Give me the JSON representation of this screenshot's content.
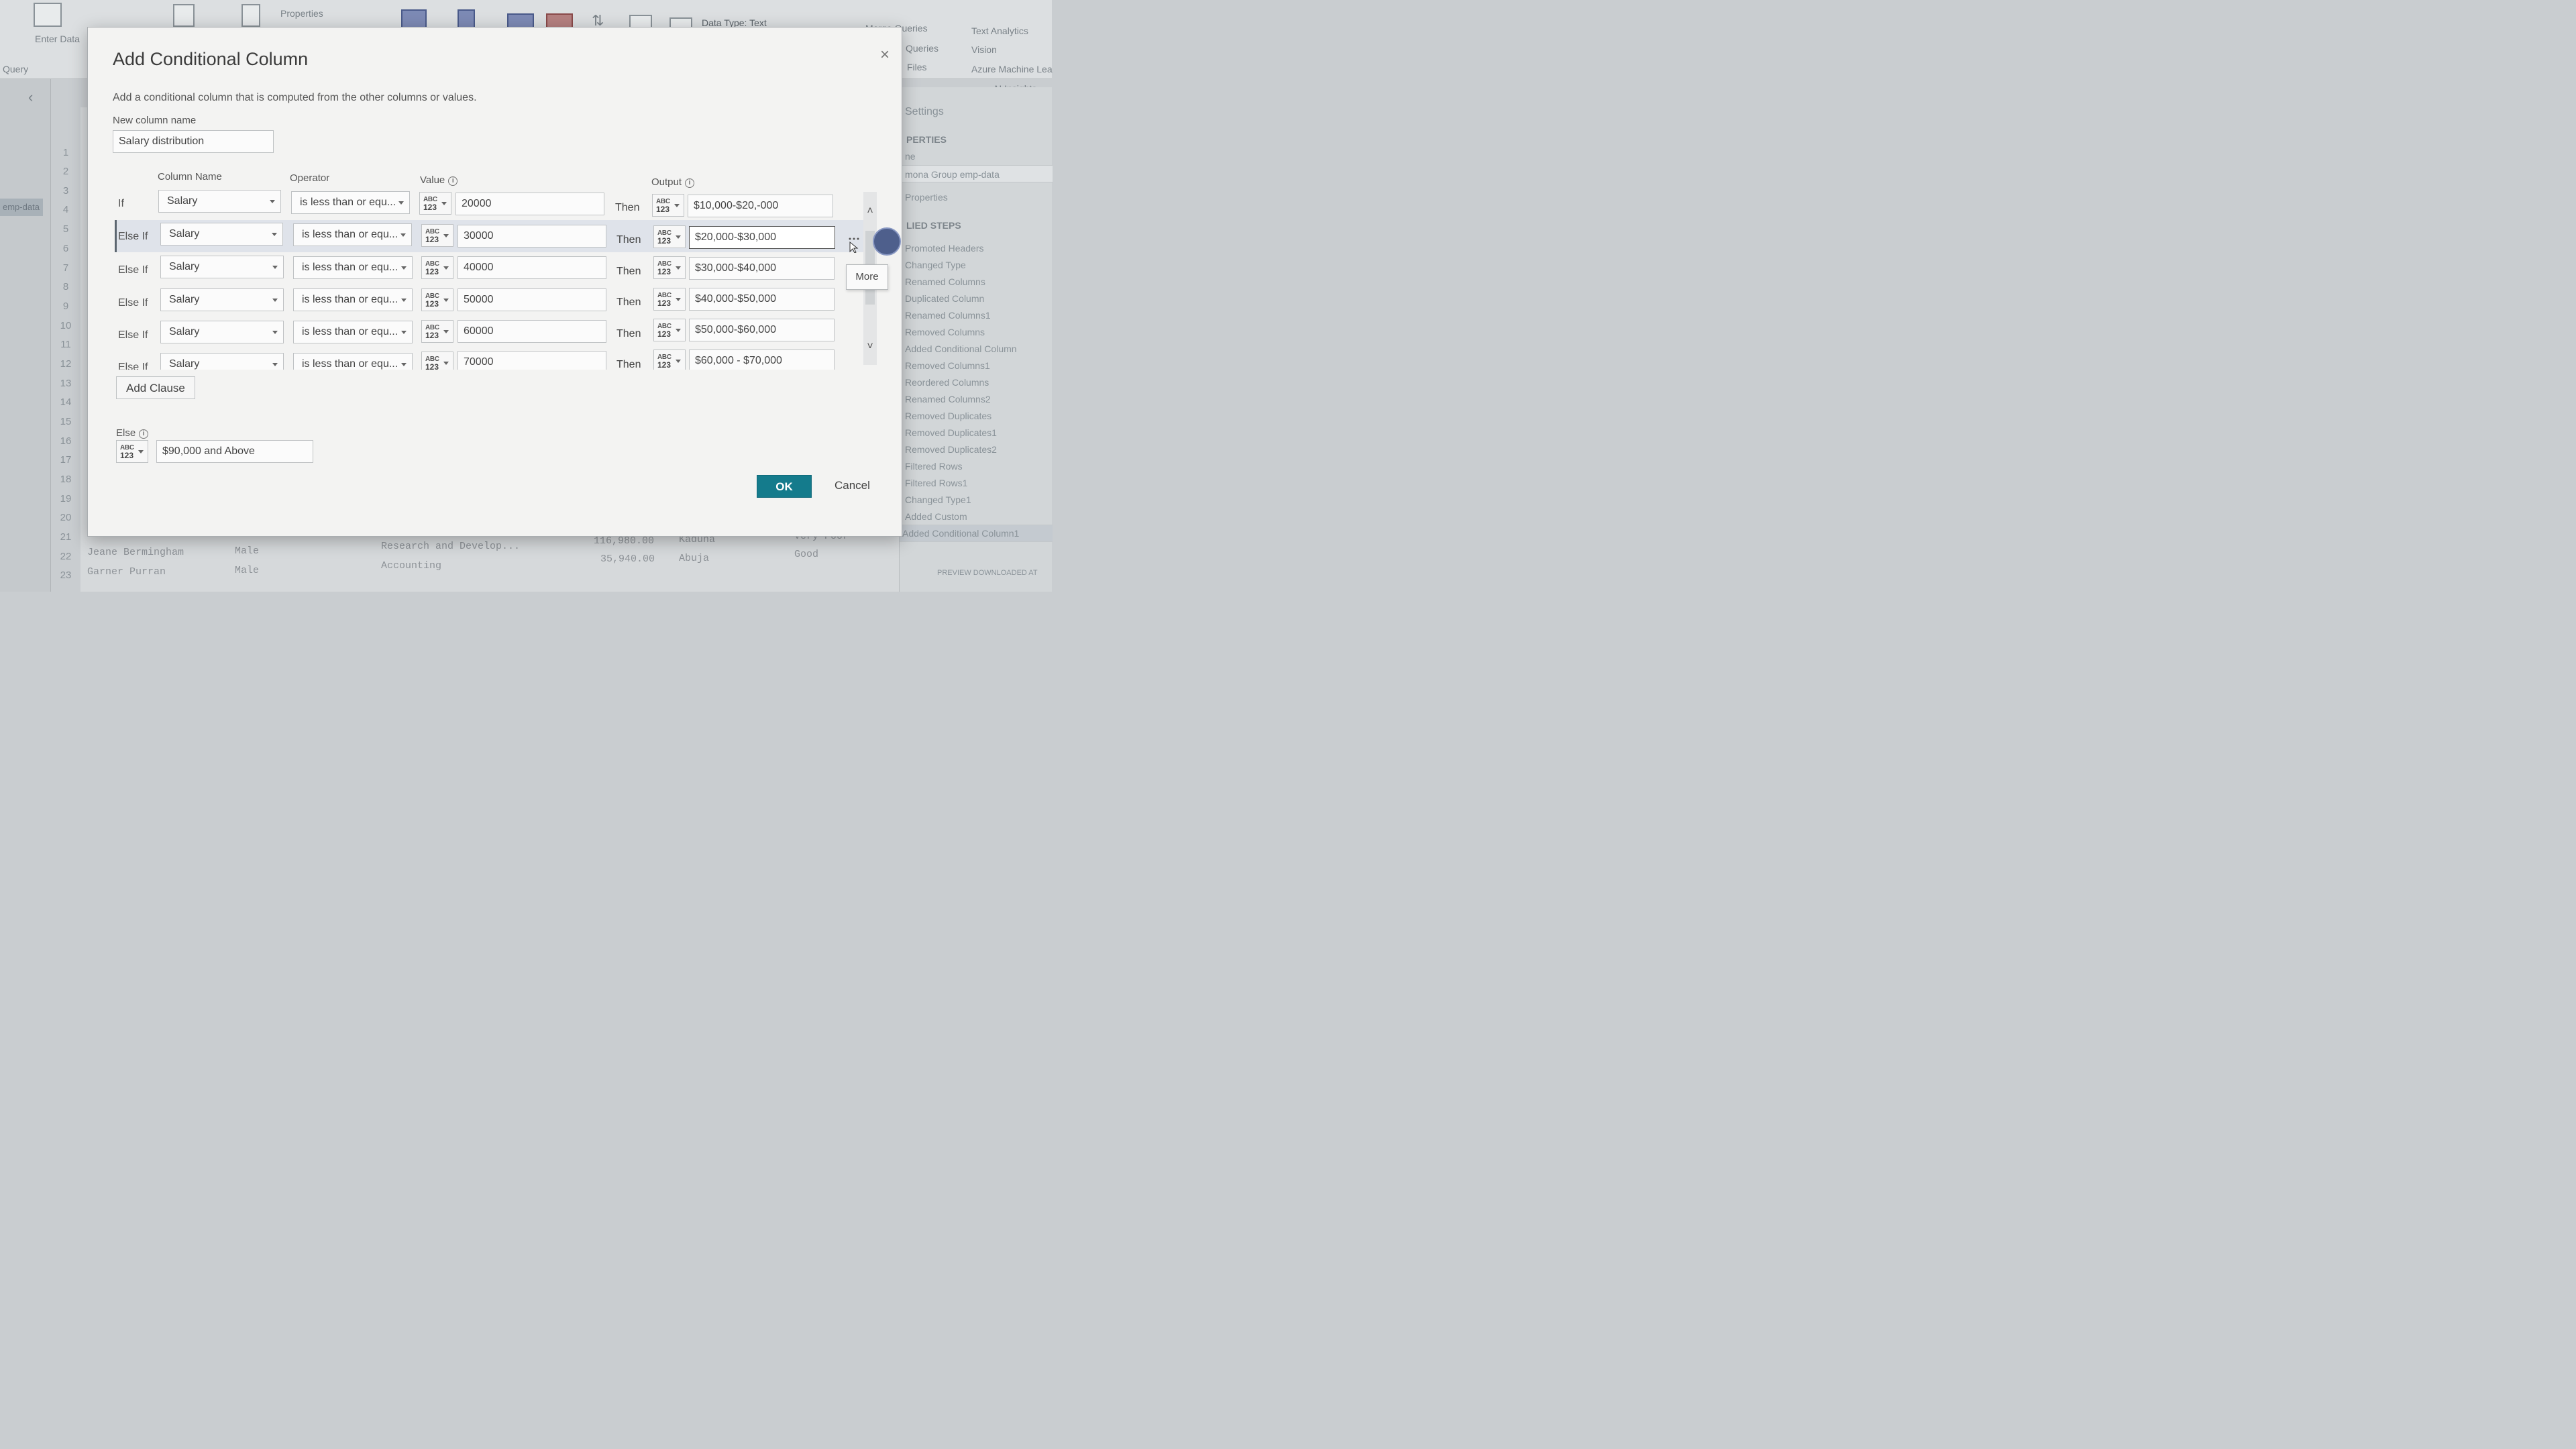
{
  "ribbon": {
    "items": [
      "Properties",
      "Data Type: Text",
      "Merge Queries",
      "Text Analytics",
      "Queries",
      "Vision",
      "Files",
      "Azure Machine Lea",
      "AI Insights",
      "Query",
      "Enter Data"
    ]
  },
  "left_pane": {
    "query_item": "emp-data"
  },
  "row_numbers": [
    "1",
    "2",
    "3",
    "4",
    "5",
    "6",
    "7",
    "8",
    "9",
    "10",
    "11",
    "12",
    "13",
    "14",
    "15",
    "16",
    "17",
    "18",
    "19",
    "20",
    "21",
    "22",
    "23"
  ],
  "background_rows": [
    {
      "name": "Jeane Bermingham",
      "gender": "Male",
      "dept": "Research and Develop...",
      "salary": "116,980.00",
      "city": "Kaduna",
      "rating": "Very Poor"
    },
    {
      "name": "Garner Purran",
      "gender": "Male",
      "dept": "Accounting",
      "salary": "35,940.00",
      "city": "Abuja",
      "rating": "Good"
    }
  ],
  "right_pane": {
    "settings_label": "Settings",
    "properties_heading": "PERTIES",
    "name_label": "ne",
    "name_value": "mona Group emp-data",
    "all_properties": "Properties",
    "steps_heading": "LIED STEPS",
    "steps": [
      "Promoted Headers",
      "Changed Type",
      "Renamed Columns",
      "Duplicated Column",
      "Renamed Columns1",
      "Removed Columns",
      "Added Conditional Column",
      "Removed Columns1",
      "Reordered Columns",
      "Renamed Columns2",
      "Removed Duplicates",
      "Removed Duplicates1",
      "Removed Duplicates2",
      "Filtered Rows",
      "Filtered Rows1",
      "Changed Type1",
      "Added Custom",
      "Added Conditional Column1"
    ],
    "footer": "PREVIEW DOWNLOADED AT"
  },
  "dialog": {
    "title": "Add Conditional Column",
    "description": "Add a conditional column that is computed from the other columns or values.",
    "new_column_label": "New column name",
    "new_column_value": "Salary distribution",
    "headers": {
      "column_name": "Column Name",
      "operator": "Operator",
      "value": "Value",
      "output": "Output"
    },
    "type_abc": "ABC",
    "type_123": "123",
    "then_label": "Then",
    "clauses": [
      {
        "label": "If",
        "column": "Salary",
        "operator": "is less than or equ...",
        "value": "20000",
        "output": "$10,000-$20,-000"
      },
      {
        "label": "Else If",
        "column": "Salary",
        "operator": "is less than or equ...",
        "value": "30000",
        "output": "$20,000-$30,000"
      },
      {
        "label": "Else If",
        "column": "Salary",
        "operator": "is less than or equ...",
        "value": "40000",
        "output": "$30,000-$40,000"
      },
      {
        "label": "Else If",
        "column": "Salary",
        "operator": "is less than or equ...",
        "value": "50000",
        "output": "$40,000-$50,000"
      },
      {
        "label": "Else If",
        "column": "Salary",
        "operator": "is less than or equ...",
        "value": "60000",
        "output": "$50,000-$60,000"
      },
      {
        "label": "Else If",
        "column": "Salary",
        "operator": "is less than or equ...",
        "value": "70000",
        "output": "$60,000 - $70,000"
      }
    ],
    "add_clause": "Add Clause",
    "else_label": "Else",
    "else_value": "$90,000 and Above",
    "more_tooltip": "More",
    "ok": "OK",
    "cancel": "Cancel",
    "accent_color": "#147b8c"
  }
}
